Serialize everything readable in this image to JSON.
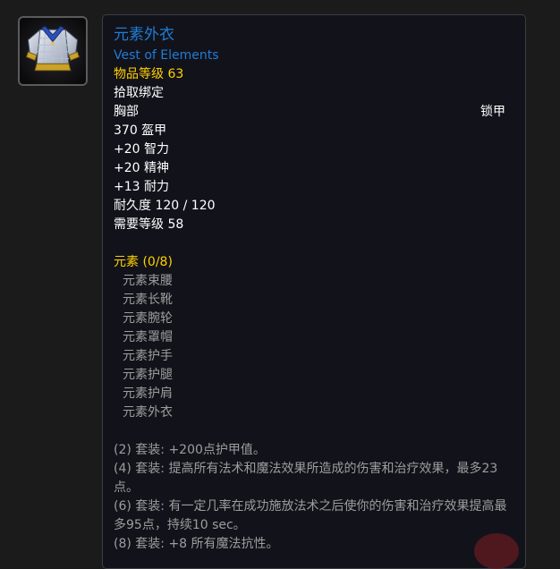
{
  "item": {
    "icon": "chest-armor-icon",
    "name_cn": "元素外衣",
    "name_en": "Vest of Elements",
    "item_level": "物品等级 63",
    "bind": "拾取绑定",
    "slot": "胸部",
    "armor_type": "锁甲",
    "armor": "370 盔甲",
    "stats": [
      "+20 智力",
      "+20 精神",
      "+13 耐力"
    ],
    "durability": "耐久度 120 / 120",
    "required_level": "需要等级 58"
  },
  "set": {
    "title": "元素 (0/8)",
    "pieces": [
      "元素束腰",
      "元素长靴",
      "元素腕轮",
      "元素罩帽",
      "元素护手",
      "元素护腿",
      "元素护肩",
      "元素外衣"
    ],
    "bonuses": [
      "(2) 套装: +200点护甲值。",
      "(4) 套装: 提高所有法术和魔法效果所造成的伤害和治疗效果，最多23点。",
      "(6) 套装: 有一定几率在成功施放法术之后使你的伤害和治疗效果提高最多95点，持续10 sec。",
      "(8) 套装: +8 所有魔法抗性。"
    ]
  },
  "colors": {
    "item_name": "#1f7dd6",
    "item_level": "#ffd100",
    "set_title": "#ffd100",
    "set_text": "#9d9d9d",
    "tooltip_bg": "#12121a"
  }
}
